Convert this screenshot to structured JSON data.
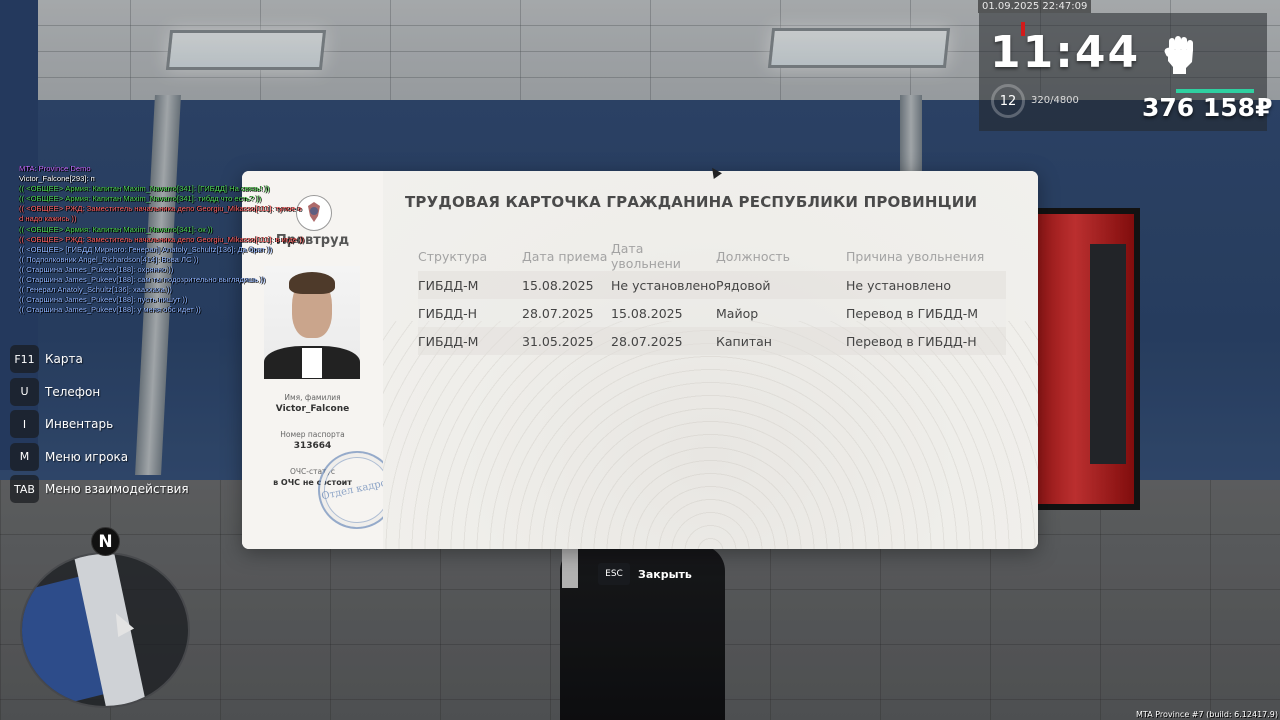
{
  "hud": {
    "datetime": "01.09.2025 22:47:09",
    "clock": "11:44",
    "timer": "12",
    "ammo": "320/4800",
    "money": "376 158₽",
    "icons": {
      "fist": "fist-icon"
    }
  },
  "chat": [
    {
      "text": "MTA: Province Demo",
      "color": "#c36cff"
    },
    {
      "text": "Victor_Falcone[293]: п",
      "color": "#ffffff"
    },
    {
      "text": "(( <ОБЩЕЕ> Армия: Капитан Maxim_Navarro[341]: [ГИБДД] На связь! ))",
      "color": "#4bd24b"
    },
    {
      "text": "(( <ОБЩЕЕ> Армия: Капитан Maxim_Navarro[341]: тибдд что есть? ))",
      "color": "#4bd24b"
    },
    {
      "text": "(( <ОБЩЕЕ> РЖД: Заместитель начальника депо Georgiu_Mikasso[111]: тупое о",
      "color": "#ff5b5b"
    },
    {
      "text": "d надо кажись ))",
      "color": "#ff5b5b"
    },
    {
      "text": "(( <ОБЩЕЕ> Армия: Капитан Maxim_Navarro[341]: ок ))",
      "color": "#4bd24b"
    },
    {
      "text": "(( <ОБЩЕЕ> РЖД: Заместитель начальника депо Georgiu_Mikasso[111]: в игде ))",
      "color": "#ff5b5b"
    },
    {
      "text": "(( <ОБЩЕЕ> [ГИБДД Мирного: Генерал] Anatoly_Schultz[136]: Да брат ))",
      "color": "#8fb4ff"
    },
    {
      "text": "(( Подполковник Angel_Richardson[414]: Вова ЛС ))",
      "color": "#8fb4ff"
    },
    {
      "text": "(( Старшина James_Pukeev[188]: охрянно ))",
      "color": "#8fb4ff"
    },
    {
      "text": "(( Старшина James_Pukeev[188]: сам ты подозрительно выглядишь ))",
      "color": "#8fb4ff"
    },
    {
      "text": "(( Генерал Anatoly_Schultz[136]: хааххаха ))",
      "color": "#8fb4ff"
    },
    {
      "text": "(( Старшина James_Pukeev[188]: пусть пишут ))",
      "color": "#8fb4ff"
    },
    {
      "text": "(( Старшина James_Pukeev[188]: у меня обс идет ))",
      "color": "#8fb4ff"
    }
  ],
  "hints": [
    {
      "key": "F11",
      "label": "Карта"
    },
    {
      "key": "U",
      "label": "Телефон"
    },
    {
      "key": "I",
      "label": "Инвентарь"
    },
    {
      "key": "M",
      "label": "Меню игрока"
    },
    {
      "key": "TAB",
      "label": "Меню взаимодействия"
    }
  ],
  "minimap": {
    "north": "N"
  },
  "card": {
    "org": "Провтруд",
    "title": "ТРУДОВАЯ КАРТОЧКА ГРАЖДАНИНА РЕСПУБЛИКИ ПРОВИНЦИИ",
    "name_label": "Имя, фамилия",
    "name": "Victor_Falcone",
    "passport_label": "Номер паспорта",
    "passport": "313664",
    "ochs_label": "ОЧС-статус",
    "ochs": "в ОЧС не состоит",
    "stamp": "Отдел кадров",
    "columns": [
      "Структура",
      "Дата приема",
      "Дата увольнени",
      "Должность",
      "Причина увольнения"
    ],
    "rows": [
      [
        "ГИБДД-М",
        "15.08.2025",
        "Не установлено",
        "Рядовой",
        "Не установлено"
      ],
      [
        "ГИБДД-Н",
        "28.07.2025",
        "15.08.2025",
        "Майор",
        "Перевод в ГИБДД-М"
      ],
      [
        "ГИБДД-М",
        "31.05.2025",
        "28.07.2025",
        "Капитан",
        "Перевод в ГИБДД-Н"
      ]
    ]
  },
  "close": {
    "key": "ESC",
    "label": "Закрыть"
  },
  "build": "MTA Province #7 (build: 6.12417.9)"
}
